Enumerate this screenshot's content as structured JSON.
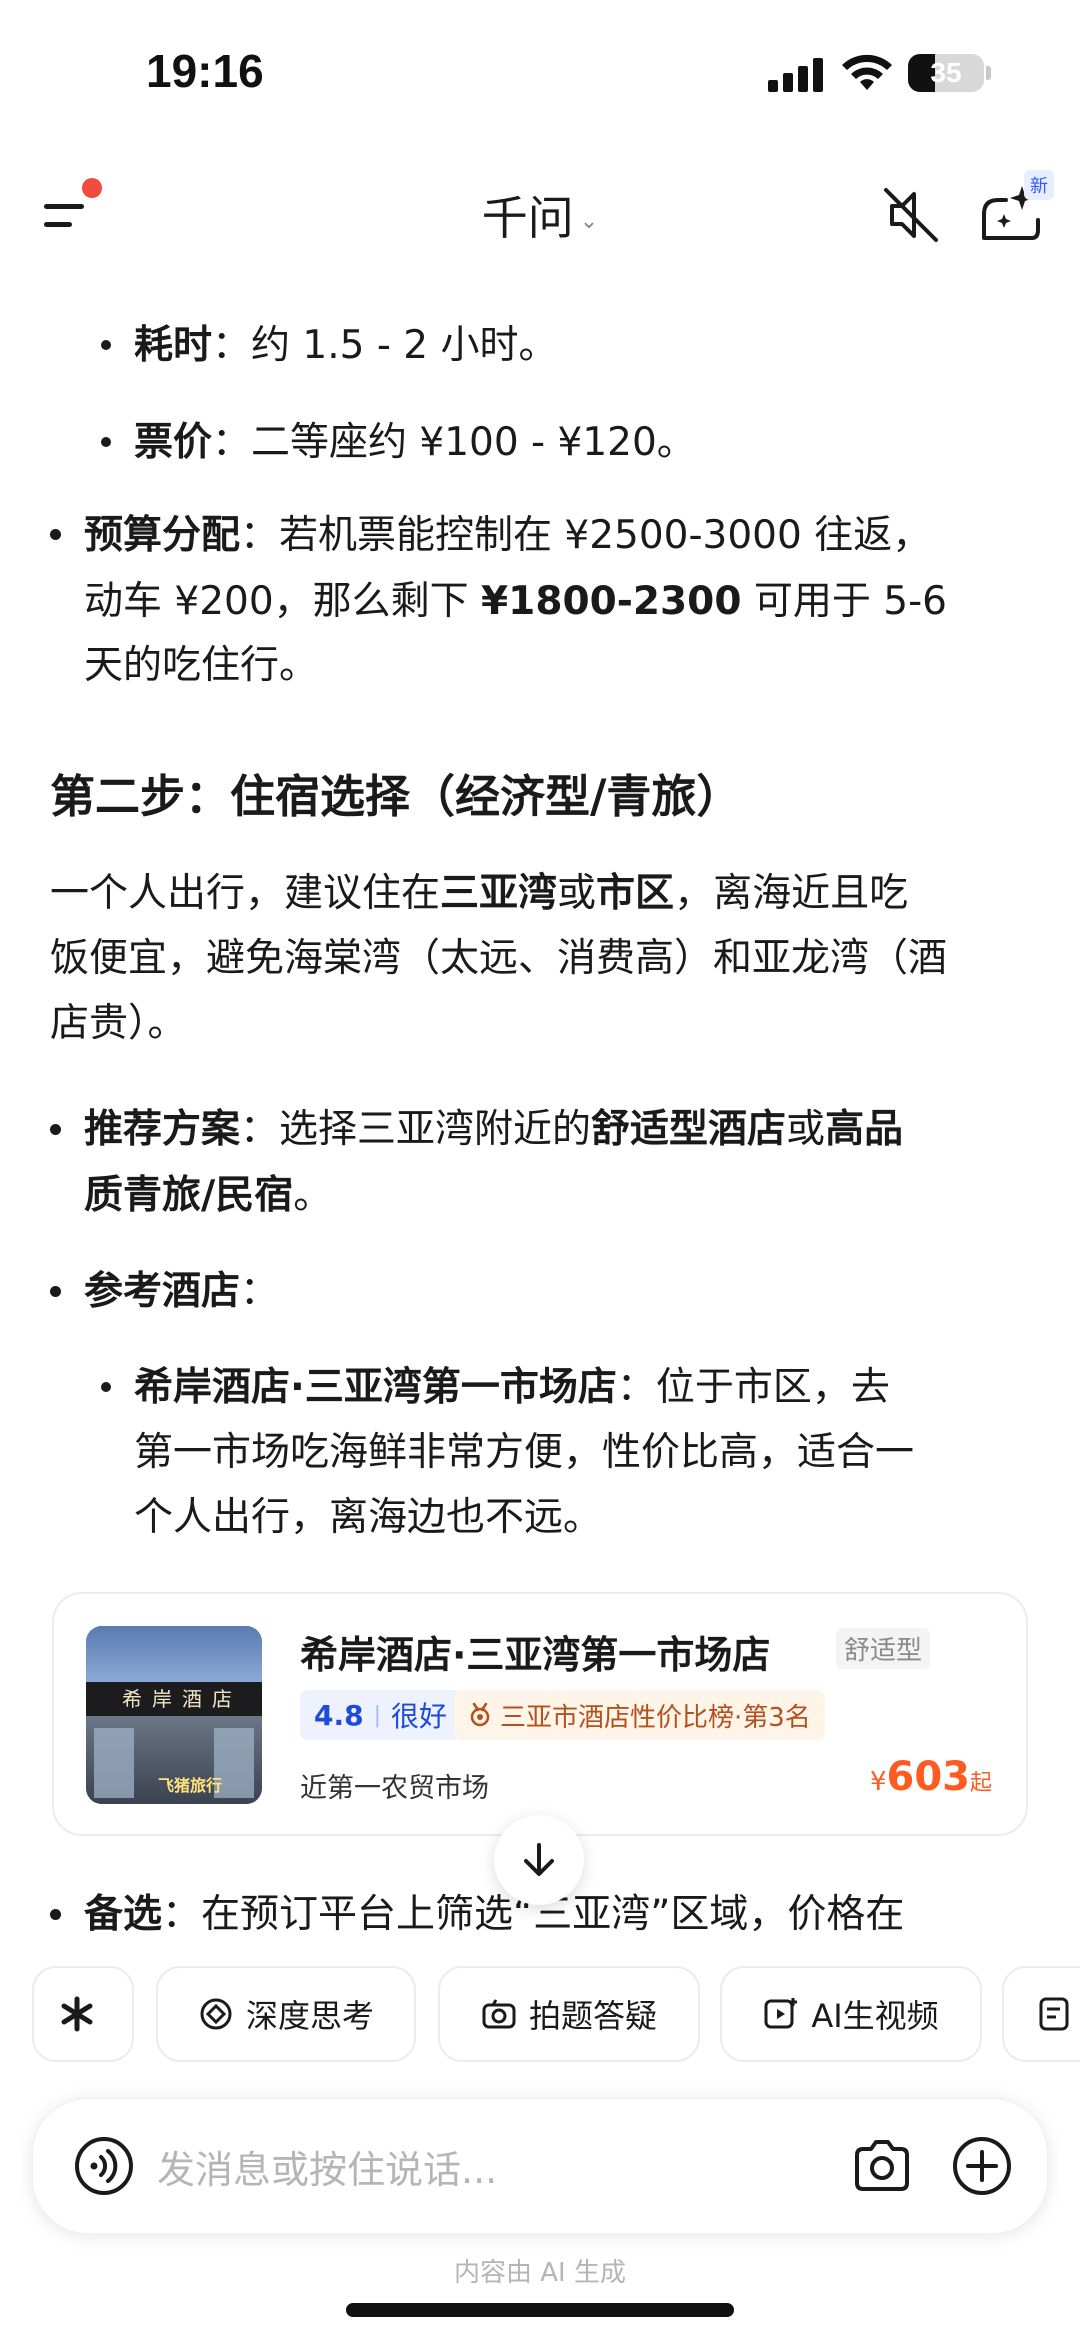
{
  "status_bar": {
    "time": "19:16",
    "battery": "35",
    "battery_level": 0.35
  },
  "header": {
    "title": "千问",
    "title_chevron": "⌄",
    "new_badge": "新"
  },
  "content": {
    "b1_label": "耗时",
    "b1_text": "：约 1.5 - 2 小时。",
    "b2_label": "票价",
    "b2_text": "：二等座约 ¥100 - ¥120。",
    "budget_label": "预算分配",
    "budget_text1": "：若机票能控制在 ¥2500-3000 往返，",
    "budget_text2a": "动车 ¥200，那么剩下 ",
    "budget_text2b": "¥1800-2300",
    "budget_text2c": " 可用于 5-6",
    "budget_text3": "天的吃住行。",
    "step2_heading": "第二步：住宿选择（经济型/青旅）",
    "p1a": "一个人出行，建议住在",
    "p1b": "三亚湾",
    "p1c": "或",
    "p1d": "市区",
    "p1e": "，离海近且吃",
    "p2": "饭便宜，避免海棠湾（太远、消费高）和亚龙湾（酒",
    "p3": "店贵）。",
    "rec_label": "推荐方案",
    "rec_text_a": "：选择三亚湾附近的",
    "rec_text_b": "舒适型酒店",
    "rec_text_c": "或",
    "rec_text_d": "高品",
    "rec_text2": "质青旅/民宿",
    "rec_text2_end": "。",
    "ref_label": "参考酒店",
    "ref_colon": "：",
    "hotel_ref_name": "希岸酒店·三亚湾第一市场店",
    "hotel_ref_text1": "：位于市区，去",
    "hotel_ref_text2": "第一市场吃海鲜非常方便，性价比高，适合一",
    "hotel_ref_text3": "个人出行，离海边也不远。",
    "alt_label": "备选",
    "alt_text": "：在预订平台上筛选“三亚湾”区域，价格在"
  },
  "hotel_card": {
    "name": "希岸酒店·三亚湾第一市场店",
    "type": "舒适型",
    "rating": "4.8",
    "rating_label": "很好",
    "rank": "三亚市酒店性价比榜·第3名",
    "location": "近第一农贸市场",
    "price_currency": "¥",
    "price": "603",
    "price_suffix": "起",
    "photo_sign": "希岸酒店",
    "photo_logo": "飞猪旅行"
  },
  "quick_actions": [
    {
      "label": ""
    },
    {
      "label": "深度思考"
    },
    {
      "label": "拍题答疑"
    },
    {
      "label": "AI生视频"
    }
  ],
  "input": {
    "placeholder": "发消息或按住说话..."
  },
  "footnote": "内容由 AI 生成"
}
